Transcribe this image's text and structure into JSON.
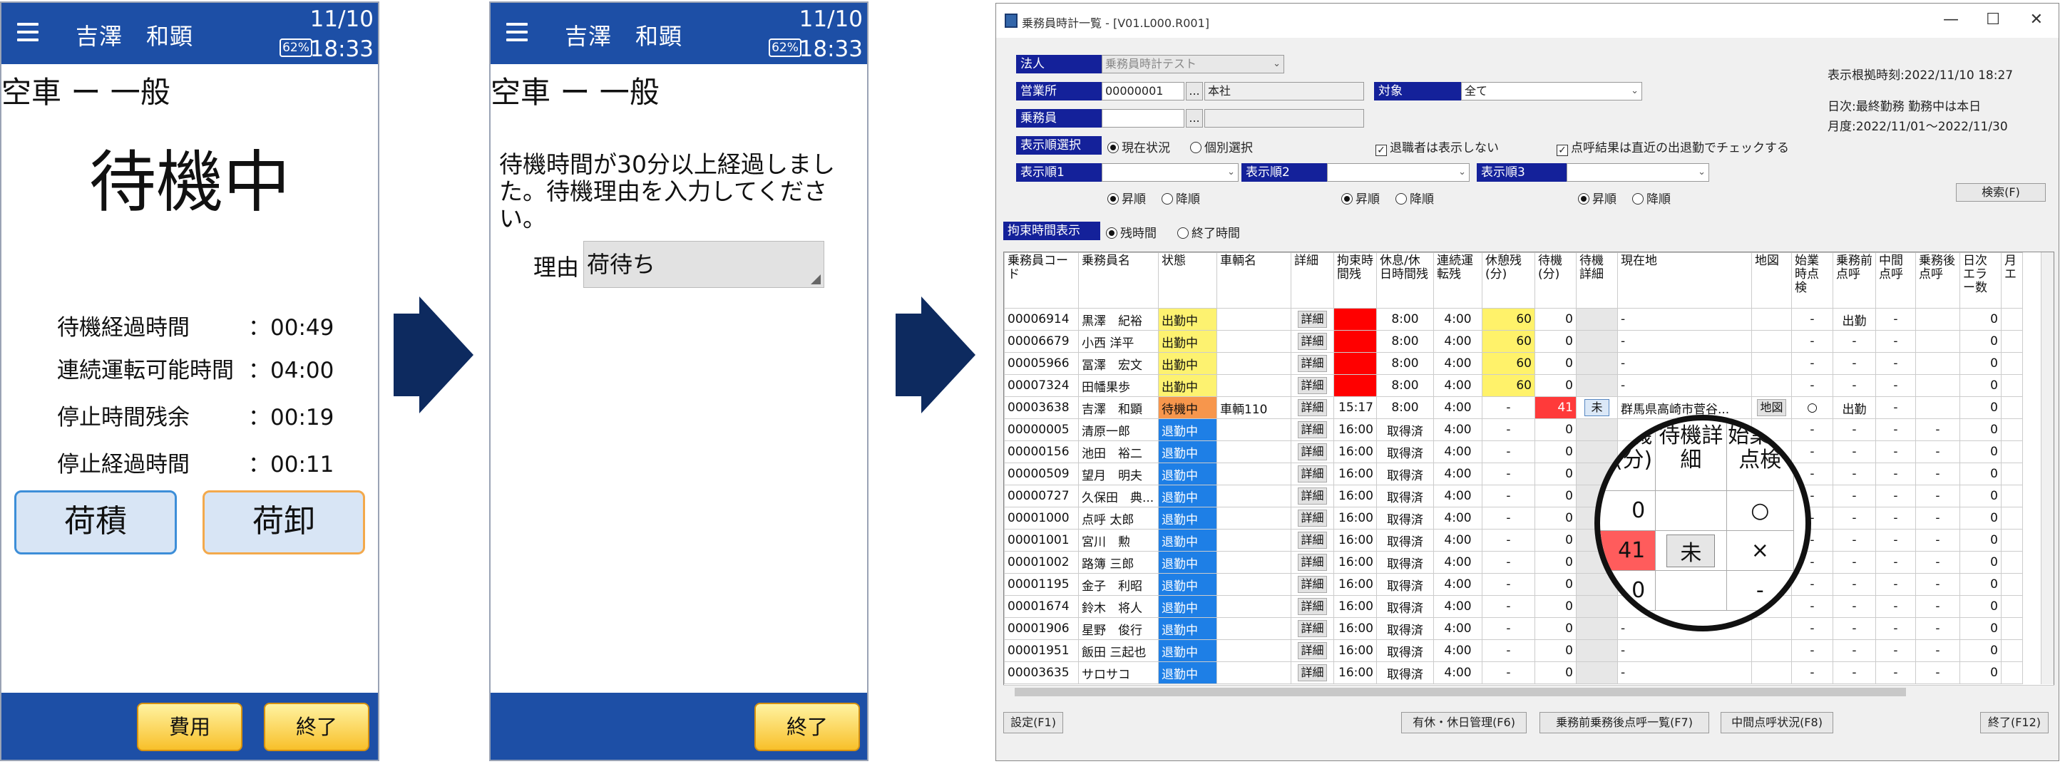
{
  "phone1": {
    "header": {
      "name": "吉澤　和顕",
      "date": "11/10",
      "time": "18:33",
      "battery": "62%"
    },
    "title": "空車 ー 一般",
    "status": "待機中",
    "rows": [
      {
        "label": "待機経過時間",
        "value": "：00:49"
      },
      {
        "label": "連続運転可能時間",
        "value": "：04:00"
      },
      {
        "label": "停止時間残余",
        "value": "：00:19"
      },
      {
        "label": "停止経過時間",
        "value": "：00:11"
      }
    ],
    "load_button": "荷積",
    "unload_button": "荷卸",
    "cost_button": "費用",
    "end_button": "終了"
  },
  "phone2": {
    "header": {
      "name": "吉澤　和顕",
      "date": "11/10",
      "time": "18:33",
      "battery": "62%"
    },
    "title": "空車 ー 一般",
    "message": "待機時間が30分以上経過しました。待機理由を入力してください。",
    "reason_label": "理由",
    "reason_value": "荷待ち",
    "end_button": "終了"
  },
  "window": {
    "title": "乗務員時計一覧 - [V01.L000.R001]",
    "corp_label": "法人",
    "corp_value": "乗務員時計テスト",
    "office_label": "営業所",
    "office_code": "00000001",
    "office_name": "本社",
    "dots": "...",
    "target_label": "対象",
    "target_value": "全て",
    "crew_label": "乗務員",
    "order_select_label": "表示順選択",
    "opt_current": "現在状況",
    "opt_individual": "個別選択",
    "chk_retired": "退職者は表示しない",
    "chk_rollcall": "点呼結果は直近の出退勤でチェックする",
    "order1": "表示順1",
    "order2": "表示順2",
    "order3": "表示順3",
    "asc": "昇順",
    "desc": "降順",
    "bind_label": "拘束時間表示",
    "opt_remaining": "残時間",
    "opt_end": "終了時間",
    "search_button": "検索(F)",
    "basis_time": "表示根拠時刻:2022/11/10 18:27",
    "daily": "日次:最終勤務 勤務中は本日",
    "monthly": "月度:2022/11/01〜2022/11/30",
    "columns": [
      "乗務員コード",
      "乗務員名",
      "状態",
      "車輌名",
      "詳細",
      "拘束時間残",
      "休息/休日時間残",
      "連続運転残",
      "休憩残(分)",
      "待機(分)",
      "待機詳細",
      "現在地",
      "地図",
      "始業時点検",
      "乗務前点呼",
      "中間点呼",
      "乗務後点呼",
      "日次エラー数",
      "月エ"
    ],
    "detail": "詳細",
    "rows": [
      {
        "code": "00006914",
        "name": "黒澤　紀裕",
        "status": "出勤中",
        "car": "",
        "bind": "",
        "rest": "8:00",
        "drive": "4:00",
        "brk": "60",
        "wait": "0",
        "wd": "",
        "loc": "-",
        "map": "",
        "start": "-",
        "pre": "出勤",
        "mid": "-",
        "post": "",
        "err": "0"
      },
      {
        "code": "00006679",
        "name": "小西 洋平",
        "status": "出勤中",
        "car": "",
        "bind": "",
        "rest": "8:00",
        "drive": "4:00",
        "brk": "60",
        "wait": "0",
        "wd": "",
        "loc": "-",
        "map": "",
        "start": "-",
        "pre": "-",
        "mid": "-",
        "post": "",
        "err": "0"
      },
      {
        "code": "00005966",
        "name": "冨澤　宏文",
        "status": "出勤中",
        "car": "",
        "bind": "",
        "rest": "8:00",
        "drive": "4:00",
        "brk": "60",
        "wait": "0",
        "wd": "",
        "loc": "-",
        "map": "",
        "start": "-",
        "pre": "-",
        "mid": "-",
        "post": "",
        "err": "0"
      },
      {
        "code": "00007324",
        "name": "田幡果歩",
        "status": "出勤中",
        "car": "",
        "bind": "",
        "rest": "8:00",
        "drive": "4:00",
        "brk": "60",
        "wait": "0",
        "wd": "",
        "loc": "-",
        "map": "",
        "start": "-",
        "pre": "-",
        "mid": "-",
        "post": "",
        "err": "0"
      },
      {
        "code": "00003638",
        "name": "吉澤　和顕",
        "status": "待機中",
        "car": "車輌110",
        "bind": "15:17",
        "rest": "8:00",
        "drive": "4:00",
        "brk": "-",
        "wait": "41",
        "wd": "未",
        "loc": "群馬県高崎市菅谷...",
        "map": "地図",
        "start": "○",
        "pre": "出勤",
        "mid": "-",
        "post": "",
        "err": "0"
      },
      {
        "code": "00000005",
        "name": "清原一郎",
        "status": "退勤中",
        "car": "",
        "bind": "16:00",
        "rest": "取得済",
        "drive": "4:00",
        "brk": "-",
        "wait": "0",
        "wd": "",
        "loc": "",
        "map": "",
        "start": "-",
        "pre": "-",
        "mid": "-",
        "post": "-",
        "err": "0"
      },
      {
        "code": "00000156",
        "name": "池田　裕二",
        "status": "退勤中",
        "car": "",
        "bind": "16:00",
        "rest": "取得済",
        "drive": "4:00",
        "brk": "-",
        "wait": "0",
        "wd": "",
        "loc": "",
        "map": "",
        "start": "-",
        "pre": "-",
        "mid": "-",
        "post": "-",
        "err": "0"
      },
      {
        "code": "00000509",
        "name": "望月　明夫",
        "status": "退勤中",
        "car": "",
        "bind": "16:00",
        "rest": "取得済",
        "drive": "4:00",
        "brk": "-",
        "wait": "0",
        "wd": "",
        "loc": "",
        "map": "",
        "start": "-",
        "pre": "-",
        "mid": "-",
        "post": "-",
        "err": "0"
      },
      {
        "code": "00000727",
        "name": "久保田　典...",
        "status": "退勤中",
        "car": "",
        "bind": "16:00",
        "rest": "取得済",
        "drive": "4:00",
        "brk": "-",
        "wait": "0",
        "wd": "",
        "loc": "",
        "map": "",
        "start": "-",
        "pre": "-",
        "mid": "-",
        "post": "-",
        "err": "0"
      },
      {
        "code": "00001000",
        "name": "点呼 太郎",
        "status": "退勤中",
        "car": "",
        "bind": "16:00",
        "rest": "取得済",
        "drive": "4:00",
        "brk": "-",
        "wait": "0",
        "wd": "",
        "loc": "",
        "map": "",
        "start": "-",
        "pre": "-",
        "mid": "-",
        "post": "-",
        "err": "0"
      },
      {
        "code": "00001001",
        "name": "宮川　勲",
        "status": "退勤中",
        "car": "",
        "bind": "16:00",
        "rest": "取得済",
        "drive": "4:00",
        "brk": "-",
        "wait": "0",
        "wd": "",
        "loc": "",
        "map": "",
        "start": "-",
        "pre": "-",
        "mid": "-",
        "post": "-",
        "err": "0"
      },
      {
        "code": "00001002",
        "name": "路簿 三郎",
        "status": "退勤中",
        "car": "",
        "bind": "16:00",
        "rest": "取得済",
        "drive": "4:00",
        "brk": "-",
        "wait": "0",
        "wd": "",
        "loc": "",
        "map": "",
        "start": "-",
        "pre": "-",
        "mid": "-",
        "post": "-",
        "err": "0"
      },
      {
        "code": "00001195",
        "name": "金子　利昭",
        "status": "退勤中",
        "car": "",
        "bind": "16:00",
        "rest": "取得済",
        "drive": "4:00",
        "brk": "-",
        "wait": "0",
        "wd": "",
        "loc": "",
        "map": "",
        "start": "-",
        "pre": "-",
        "mid": "-",
        "post": "-",
        "err": "0"
      },
      {
        "code": "00001674",
        "name": "鈴木　将人",
        "status": "退勤中",
        "car": "",
        "bind": "16:00",
        "rest": "取得済",
        "drive": "4:00",
        "brk": "-",
        "wait": "0",
        "wd": "",
        "loc": "",
        "map": "",
        "start": "-",
        "pre": "-",
        "mid": "-",
        "post": "-",
        "err": "0"
      },
      {
        "code": "00001906",
        "name": "星野　俊行",
        "status": "退勤中",
        "car": "",
        "bind": "16:00",
        "rest": "取得済",
        "drive": "4:00",
        "brk": "-",
        "wait": "0",
        "wd": "",
        "loc": "-",
        "map": "",
        "start": "-",
        "pre": "-",
        "mid": "-",
        "post": "-",
        "err": "0"
      },
      {
        "code": "00001951",
        "name": "飯田 三起也",
        "status": "退勤中",
        "car": "",
        "bind": "16:00",
        "rest": "取得済",
        "drive": "4:00",
        "brk": "-",
        "wait": "0",
        "wd": "",
        "loc": "-",
        "map": "",
        "start": "-",
        "pre": "-",
        "mid": "-",
        "post": "-",
        "err": "0"
      },
      {
        "code": "00003635",
        "name": "サロサコ",
        "status": "退勤中",
        "car": "",
        "bind": "16:00",
        "rest": "取得済",
        "drive": "4:00",
        "brk": "-",
        "wait": "0",
        "wd": "",
        "loc": "-",
        "map": "",
        "start": "-",
        "pre": "-",
        "mid": "-",
        "post": "-",
        "err": "0"
      }
    ],
    "footer": {
      "settings": "設定(F1)",
      "holiday": "有休・休日管理(F6)",
      "rollcall_list": "乗務前乗務後点呼一覧(F7)",
      "mid_rollcall": "中間点呼状況(F8)",
      "end": "終了(F12)"
    }
  },
  "magnifier": {
    "headers": [
      "待機(分)",
      "待機詳細",
      "始業時点検"
    ],
    "rows": [
      [
        "0",
        "",
        "○"
      ],
      [
        "41",
        "未",
        "×"
      ],
      [
        "0",
        "",
        "-"
      ]
    ]
  },
  "colors": {
    "header_blue": "#1d4fa6",
    "arrow": "#0d2a5f",
    "label_blue": "#14219a",
    "waiting": "#f7964c",
    "on_duty": "#fdf270",
    "off_duty": "#1e7fe6",
    "alert": "#ff0000"
  }
}
